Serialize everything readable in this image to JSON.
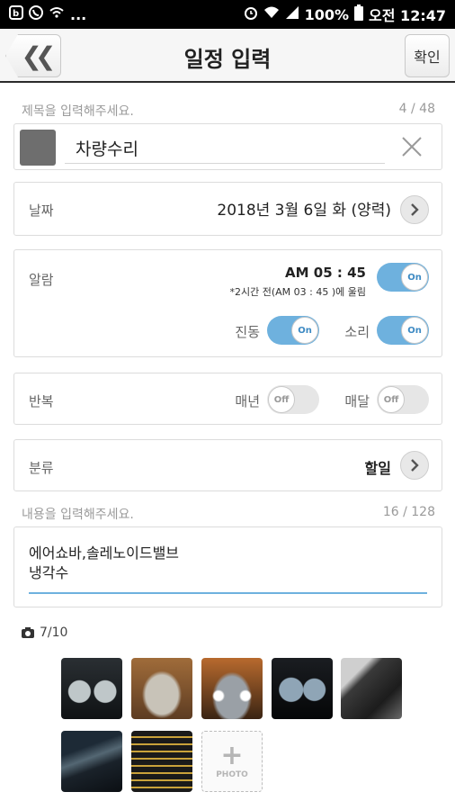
{
  "status_bar": {
    "left_icons": [
      "notification-icon",
      "call-icon",
      "wifi-calling-icon"
    ],
    "left_more": "...",
    "battery": "100%",
    "time": "오전 12:47"
  },
  "header": {
    "title": "일정 입력",
    "confirm_label": "확인",
    "back_icon": "double-chevron-left-icon"
  },
  "title_section": {
    "hint": "제목을 입력해주세요.",
    "counter": "4 / 48",
    "value": "차량수리",
    "swatch_color": "#6e6e6e"
  },
  "date_row": {
    "label": "날짜",
    "value": "2018년 3월 6일 화 (양력)"
  },
  "alarm_row": {
    "label": "알람",
    "time": "AM 05 : 45",
    "note": "*2시간 전(AM 03 : 45 )에 울림",
    "toggle": "On",
    "vibrate_label": "진동",
    "vibrate_toggle": "On",
    "sound_label": "소리",
    "sound_toggle": "On"
  },
  "repeat_row": {
    "label": "반복",
    "yearly_label": "매년",
    "yearly_toggle": "Off",
    "monthly_label": "매달",
    "monthly_toggle": "Off"
  },
  "category_row": {
    "label": "분류",
    "value": "할일"
  },
  "memo_section": {
    "hint": "내용을 입력해주세요.",
    "counter": "16 / 128",
    "value": "에어쇼바,솔레노이드밸브\n냉각수"
  },
  "photos": {
    "count": "7/10",
    "add_label": "PHOTO",
    "items": [
      "dashboard-photo",
      "car-front-photo",
      "car-headlights-photo",
      "gauge-cluster-photo",
      "interior-part-photo",
      "engine-bay-photo",
      "service-screen-photo"
    ]
  },
  "colors": {
    "accent": "#6eb1de",
    "header_border": "#2b2b2b"
  }
}
